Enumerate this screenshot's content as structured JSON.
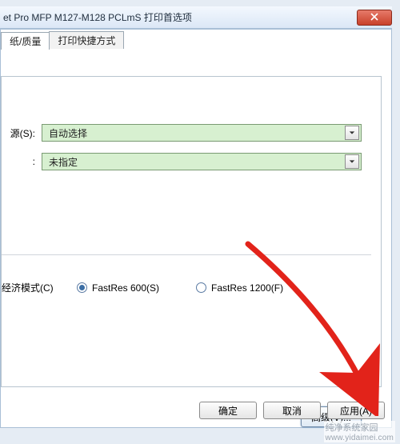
{
  "window": {
    "title": "et Pro MFP M127-M128 PCLmS 打印首选项"
  },
  "tabs": [
    {
      "label": "纸/质量",
      "active": true
    },
    {
      "label": "打印快捷方式",
      "active": false
    }
  ],
  "form": {
    "source": {
      "label": "源(S):",
      "value": "自动选择"
    },
    "mediatype": {
      "label": ":",
      "value": "未指定"
    }
  },
  "quality": {
    "eco_label": "经济模式(C)",
    "options": [
      {
        "label": "FastRes 600(S)",
        "selected": true
      },
      {
        "label": "FastRes 1200(F)",
        "selected": false
      }
    ]
  },
  "advanced_btn": "高级(V)...",
  "buttons": {
    "ok": "确定",
    "cancel": "取消",
    "apply": "应用(A)"
  },
  "watermark": {
    "line1": "纯净系统家园",
    "line2": "www.yidaimei.com"
  }
}
